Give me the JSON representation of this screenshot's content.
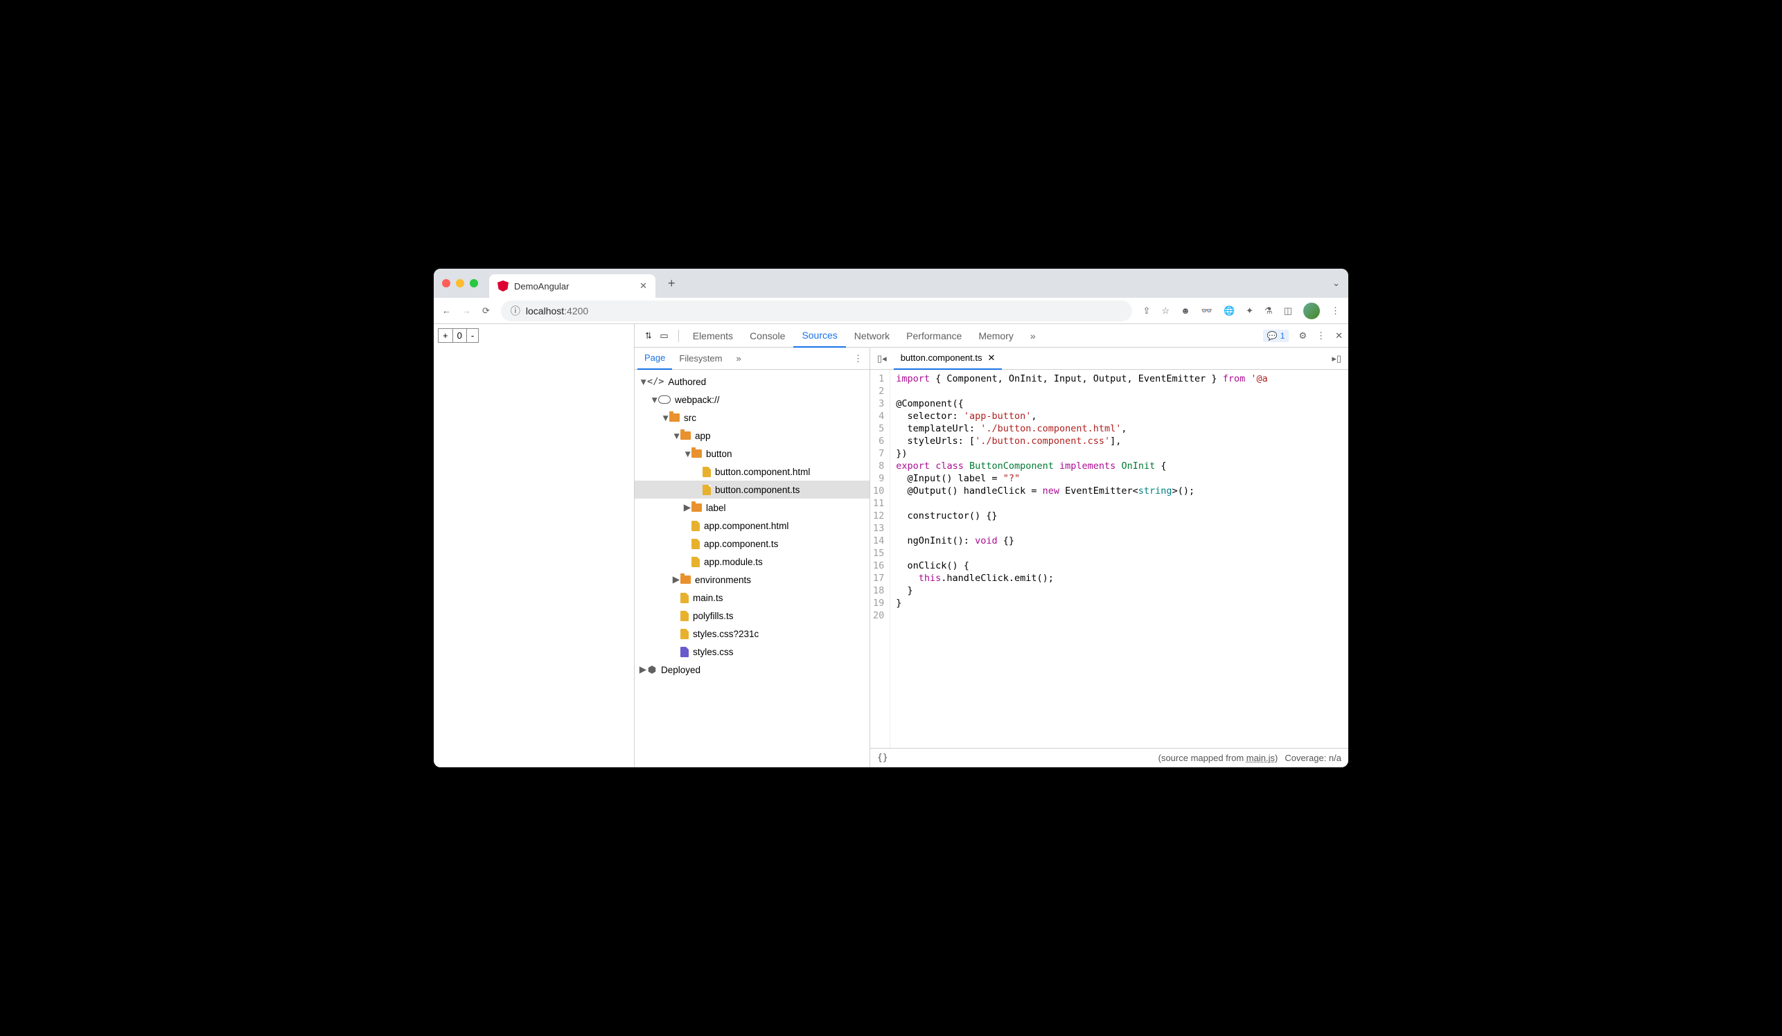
{
  "browser": {
    "tab_title": "DemoAngular",
    "url_host": "localhost",
    "url_port": ":4200"
  },
  "page": {
    "counter_plus": "+",
    "counter_value": "0",
    "counter_minus": "-"
  },
  "devtools": {
    "tabs": [
      "Elements",
      "Console",
      "Sources",
      "Network",
      "Performance",
      "Memory"
    ],
    "active_tab": "Sources",
    "issues_count": "1",
    "nav_tabs": [
      "Page",
      "Filesystem"
    ],
    "source_tree": {
      "authored": "Authored",
      "webpack": "webpack://",
      "src": "src",
      "app": "app",
      "button": "button",
      "button_html": "button.component.html",
      "button_ts": "button.component.ts",
      "label": "label",
      "app_html": "app.component.html",
      "app_ts": "app.component.ts",
      "app_module": "app.module.ts",
      "environments": "environments",
      "main_ts": "main.ts",
      "polyfills": "polyfills.ts",
      "styles_q": "styles.css?231c",
      "styles": "styles.css",
      "deployed": "Deployed"
    },
    "open_file": "button.component.ts",
    "code_lines": [
      {
        "n": 1,
        "html": "<span class='k-red'>import</span> { Component, OnInit, Input, Output, EventEmitter } <span class='k-red'>from</span> <span class='k-str'>'@a</span>"
      },
      {
        "n": 2,
        "html": ""
      },
      {
        "n": 3,
        "html": "@Component({"
      },
      {
        "n": 4,
        "html": "  selector: <span class='k-str'>'app-button'</span>,"
      },
      {
        "n": 5,
        "html": "  templateUrl: <span class='k-str'>'./button.component.html'</span>,"
      },
      {
        "n": 6,
        "html": "  styleUrls: [<span class='k-str'>'./button.component.css'</span>],"
      },
      {
        "n": 7,
        "html": "})"
      },
      {
        "n": 8,
        "html": "<span class='k-red'>export</span> <span class='k-red'>class</span> <span class='k-green'>ButtonComponent</span> <span class='k-red'>implements</span> <span class='k-green'>OnInit</span> {"
      },
      {
        "n": 9,
        "html": "  @Input() label = <span class='k-str'>\"?\"</span>"
      },
      {
        "n": 10,
        "html": "  @Output() handleClick = <span class='k-red'>new</span> EventEmitter&lt;<span class='k-teal'>string</span>&gt;();"
      },
      {
        "n": 11,
        "html": ""
      },
      {
        "n": 12,
        "html": "  constructor() {}"
      },
      {
        "n": 13,
        "html": ""
      },
      {
        "n": 14,
        "html": "  ngOnInit(): <span class='k-red'>void</span> {}"
      },
      {
        "n": 15,
        "html": ""
      },
      {
        "n": 16,
        "html": "  onClick() {"
      },
      {
        "n": 17,
        "html": "    <span class='k-red'>this</span>.handleClick.emit();"
      },
      {
        "n": 18,
        "html": "  }"
      },
      {
        "n": 19,
        "html": "}"
      },
      {
        "n": 20,
        "html": ""
      }
    ],
    "status": {
      "map_prefix": "(source mapped from ",
      "map_link": "main.js",
      "map_suffix": ")",
      "coverage": "Coverage: n/a"
    }
  }
}
